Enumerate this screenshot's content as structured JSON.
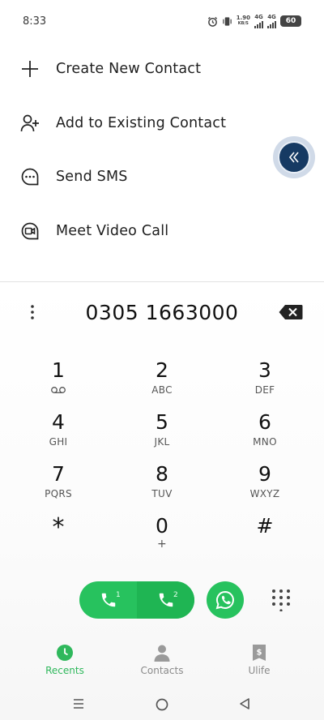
{
  "status": {
    "time": "8:33",
    "speed_value": "1.90",
    "speed_unit": "KB/S",
    "net1": "4G",
    "net2": "4G",
    "battery": "60"
  },
  "menu": {
    "items": [
      {
        "label": "Create New Contact",
        "icon": "plus-icon"
      },
      {
        "label": "Add to Existing Contact",
        "icon": "add-person-icon"
      },
      {
        "label": "Send SMS",
        "icon": "sms-icon"
      },
      {
        "label": "Meet Video Call",
        "icon": "video-call-icon"
      }
    ]
  },
  "dialer": {
    "number": "0305 1663000",
    "keys": [
      {
        "digit": "1",
        "letters": ""
      },
      {
        "digit": "2",
        "letters": "ABC"
      },
      {
        "digit": "3",
        "letters": "DEF"
      },
      {
        "digit": "4",
        "letters": "GHI"
      },
      {
        "digit": "5",
        "letters": "JKL"
      },
      {
        "digit": "6",
        "letters": "MNO"
      },
      {
        "digit": "7",
        "letters": "PQRS"
      },
      {
        "digit": "8",
        "letters": "TUV"
      },
      {
        "digit": "9",
        "letters": "WXYZ"
      },
      {
        "digit": "*",
        "letters": ""
      },
      {
        "digit": "0",
        "letters": "+"
      },
      {
        "digit": "#",
        "letters": ""
      }
    ],
    "sim1": "1",
    "sim2": "2"
  },
  "nav": {
    "recents": "Recents",
    "contacts": "Contacts",
    "ulife": "Ulife"
  },
  "colors": {
    "accent": "#27c25e",
    "bubble": "#163a63"
  }
}
